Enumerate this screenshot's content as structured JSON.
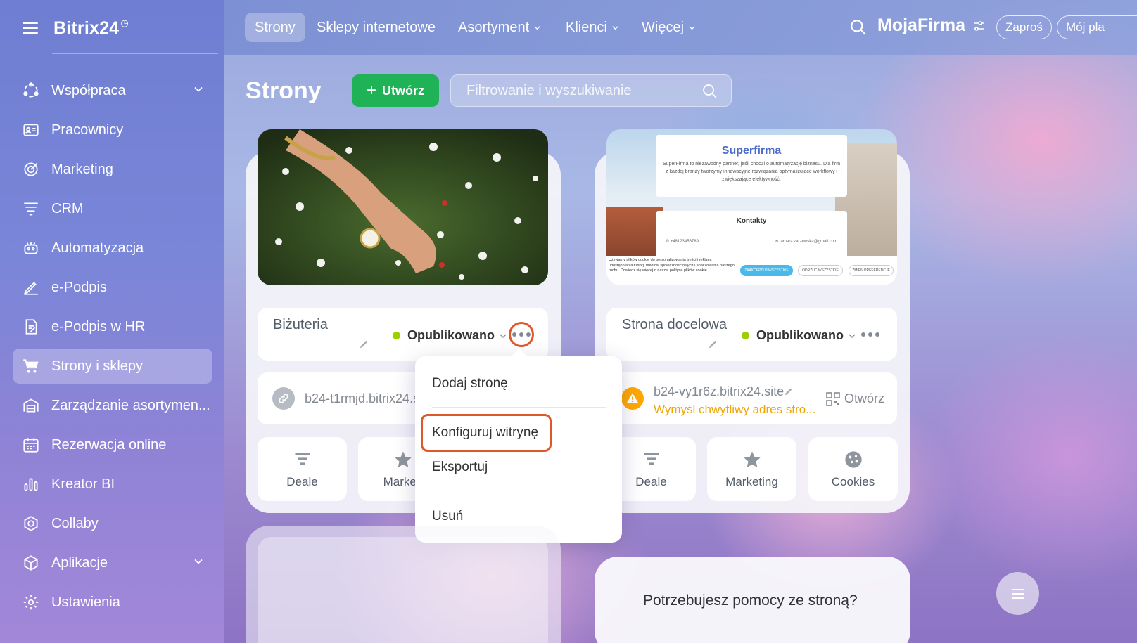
{
  "sidebar": {
    "brand": "Bitrix24",
    "items": [
      {
        "label": "Współpraca",
        "icon": "collaboration-icon",
        "chevron": true
      },
      {
        "label": "Pracownicy",
        "icon": "employees-icon"
      },
      {
        "label": "Marketing",
        "icon": "marketing-icon"
      },
      {
        "label": "CRM",
        "icon": "crm-icon"
      },
      {
        "label": "Automatyzacja",
        "icon": "automation-icon"
      },
      {
        "label": "e-Podpis",
        "icon": "esign-icon"
      },
      {
        "label": "e-Podpis w HR",
        "icon": "esign-hr-icon"
      },
      {
        "label": "Strony i sklepy",
        "icon": "cart-icon",
        "active": true
      },
      {
        "label": "Zarządzanie asortymen...",
        "icon": "inventory-icon"
      },
      {
        "label": "Rezerwacja online",
        "icon": "calendar-icon"
      },
      {
        "label": "Kreator BI",
        "icon": "bi-chart-icon"
      },
      {
        "label": "Collaby",
        "icon": "collaby-icon"
      },
      {
        "label": "Aplikacje",
        "icon": "apps-cube-icon",
        "chevron": true
      },
      {
        "label": "Ustawienia",
        "icon": "settings-gear-icon"
      }
    ]
  },
  "topbar": {
    "tabs": [
      {
        "label": "Strony",
        "active": true
      },
      {
        "label": "Sklepy internetowe"
      },
      {
        "label": "Asortyment",
        "dropdown": true
      },
      {
        "label": "Klienci",
        "dropdown": true
      },
      {
        "label": "Więcej",
        "dropdown": true
      }
    ],
    "company": "MojaFirma",
    "invite": "Zaproś",
    "plan": "Mój pla"
  },
  "header": {
    "title": "Strony",
    "create": "Utwórz",
    "filter_placeholder": "Filtrowanie i wyszukiwanie"
  },
  "cards": [
    {
      "name": "Biżuteria",
      "status": "Opublikowano",
      "url": "b24-t1rmjd.bitrix24.s",
      "tiles": [
        "Deale",
        "Marketi"
      ]
    },
    {
      "name": "Strona docelowa",
      "status": "Opublikowano",
      "url": "b24-vy1r6z.bitrix24.site",
      "warning": "Wymyśl chwytliwy adres stro...",
      "open": "Otwórz",
      "tiles": [
        "Deale",
        "Marketing",
        "Cookies"
      ],
      "preview": {
        "title": "Superfirma",
        "body": "SuperFirma to niezawodny partner, jeśli chodzi o automatyzację biznesu. Dla firm z każdej branży tworzymy innowacyjne rozwiązania optymalizujące workflowy i zwiększające efektywność.",
        "contacts_title": "Kontakty",
        "phone": "+48123456789",
        "email": "tamara.zarzewska@gmail.com",
        "cookie_text": "Używamy plików cookie do personalizowania treści i reklam, udostępniania funkcji mediów społecznościowych i analizowania naszego ruchu. Dowiedz się więcej o naszej polityce plików cookie.",
        "btn_accept": "ZAAKCEPTUJ WSZYSTKIE",
        "btn_reject": "ODRZUĆ WSZYSTKIE",
        "btn_prefs": "ZMIEŃ PREFERENCJE"
      }
    }
  ],
  "dropdown": {
    "items": [
      "Dodaj stronę",
      "Konfiguruj witrynę",
      "Eksportuj",
      "Usuń"
    ]
  },
  "help": {
    "text": "Potrzebujesz pomocy ze stroną?"
  },
  "colors": {
    "accent_green": "#1fb257",
    "status_green": "#9dcf00",
    "highlight": "#e0582a",
    "warning": "#f0a500"
  }
}
